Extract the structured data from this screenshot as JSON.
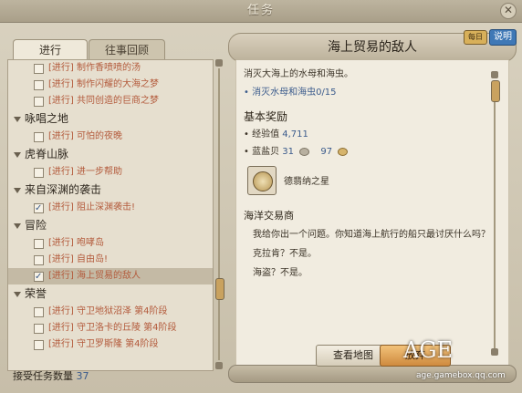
{
  "window": {
    "title": "任务",
    "close_icon": "close-icon"
  },
  "tabs": {
    "active": "进行",
    "history": "往事回顾"
  },
  "quest_list": [
    {
      "type": "quest",
      "label": "[进行] 制作香喷喷的汤",
      "checked": false
    },
    {
      "type": "quest",
      "label": "[进行] 制作闪耀的大海之梦",
      "checked": false
    },
    {
      "type": "quest",
      "label": "[进行] 共同创造的巨商之梦",
      "checked": false
    },
    {
      "type": "category",
      "label": "咏唱之地"
    },
    {
      "type": "quest",
      "label": "[进行] 可怕的夜晚",
      "checked": false
    },
    {
      "type": "category",
      "label": "虎脊山脉"
    },
    {
      "type": "quest",
      "label": "[进行] 进一步帮助",
      "checked": false
    },
    {
      "type": "category",
      "label": "来自深渊的袭击"
    },
    {
      "type": "quest",
      "label": "[进行] 阻止深渊袭击!",
      "checked": true
    },
    {
      "type": "category",
      "label": "冒险"
    },
    {
      "type": "quest",
      "label": "[进行] 咆哮岛",
      "checked": false
    },
    {
      "type": "quest",
      "label": "[进行] 自由岛!",
      "checked": false
    },
    {
      "type": "quest",
      "label": "[进行] 海上贸易的敌人",
      "checked": true,
      "selected": true
    },
    {
      "type": "category",
      "label": "荣誉"
    },
    {
      "type": "quest",
      "label": "[进行] 守卫地狱沼泽 第4阶段",
      "checked": false
    },
    {
      "type": "quest",
      "label": "[进行] 守卫洛卡的丘陵 第4阶段",
      "checked": false
    },
    {
      "type": "quest",
      "label": "[进行] 守卫罗斯隆 第4阶段",
      "checked": false
    }
  ],
  "footer": {
    "label": "接受任务数量",
    "count": "37"
  },
  "detail": {
    "title": "海上贸易的敌人",
    "badge_daily": "每日",
    "badge_info": "说明",
    "description": "消灭大海上的水母和海虫。",
    "objective": "• 消灭水母和海虫0/15",
    "reward_header": "基本奖励",
    "exp_label": "• 经验值",
    "exp_value": "4,711",
    "currency_label": "• 蓝盐贝",
    "currency_silver": "31",
    "currency_gold": "97",
    "item_name": "德翡纳之星",
    "npc_name": "海洋交易商",
    "dialogue_1": "我给你出一个问题。你知道海上航行的船只最讨厌什么吗？",
    "dialogue_2": "克拉肯？不是。",
    "dialogue_3": "海盗？不是。",
    "btn_map": "查看地图",
    "btn_abandon": "放弃"
  },
  "watermark": {
    "logo": "AGE",
    "sub": "age.gamebox.qq.com"
  },
  "colors": {
    "accent_blue": "#3b5b8c",
    "quest_text": "#b35a3b",
    "gold": "#d6b46c"
  }
}
